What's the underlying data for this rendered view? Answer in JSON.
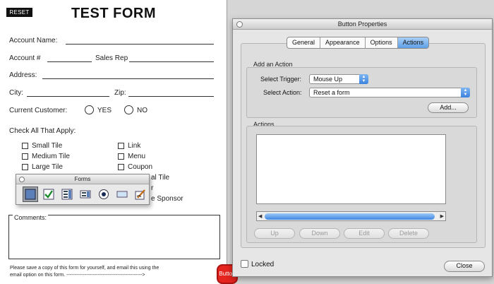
{
  "form": {
    "reset_label": "RESET",
    "title": "TEST FORM",
    "account_name": "Account Name:",
    "account_no": "Account #",
    "sales_rep": "Sales Rep",
    "address": "Address:",
    "city": "City:",
    "zip": "Zip:",
    "current_customer": "Current Customer:",
    "yes": "YES",
    "no": "NO",
    "check_all": "Check All That Apply:",
    "checkboxes_left": [
      "Small Tile",
      "Medium Tile",
      "Large Tile"
    ],
    "checkboxes_right": [
      "Link",
      "Menu",
      "Coupon"
    ],
    "partial_right": [
      "al Tile",
      "r",
      "e Sponsor"
    ],
    "comments_label": "Comments:",
    "note_line1": "Please save a copy of this form for yourself, and email this using the",
    "note_line2": "email option on this form. ---------------------------------------------->",
    "red_button_label": "Button"
  },
  "forms_palette": {
    "title": "Forms",
    "tools": [
      "button-tool-icon",
      "checkbox-tool-icon",
      "combo-box-tool-icon",
      "list-box-tool-icon",
      "radio-button-tool-icon",
      "text-field-tool-icon",
      "signature-tool-icon"
    ],
    "selected_index": 0
  },
  "dialog": {
    "title": "Button Properties",
    "tabs": [
      "General",
      "Appearance",
      "Options",
      "Actions"
    ],
    "active_tab": "Actions",
    "add_action_label": "Add an Action",
    "select_trigger_label": "Select Trigger:",
    "trigger_value": "Mouse Up",
    "select_action_label": "Select Action:",
    "action_value": "Reset a form",
    "add_button": "Add...",
    "actions_label": "Actions",
    "list_buttons": [
      "Up",
      "Down",
      "Edit",
      "Delete"
    ],
    "locked_label": "Locked",
    "close_button": "Close"
  },
  "colors": {
    "tab_active": "#5e9fe6",
    "red_button": "#e5241f"
  }
}
